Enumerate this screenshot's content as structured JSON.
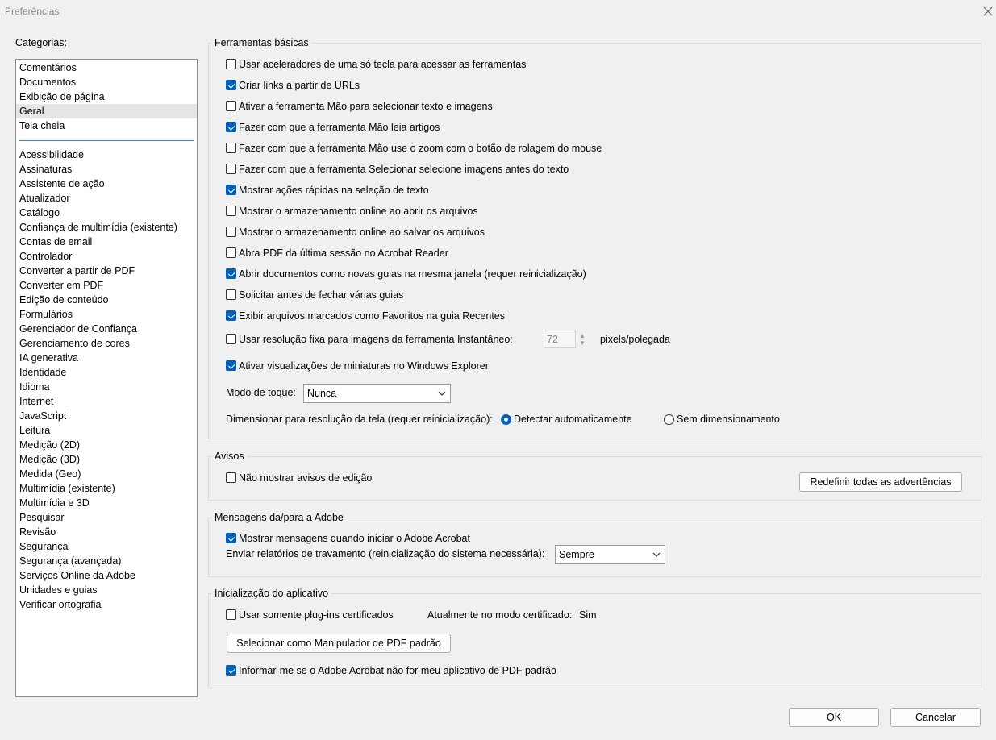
{
  "window": {
    "title": "Preferências"
  },
  "categories": {
    "label": "Categorias:",
    "top": [
      "Comentários",
      "Documentos",
      "Exibição de página",
      "Geral",
      "Tela cheia"
    ],
    "selected": "Geral",
    "bottom": [
      "Acessibilidade",
      "Assinaturas",
      "Assistente de ação",
      "Atualizador",
      "Catálogo",
      "Confiança de multimídia (existente)",
      "Contas de email",
      "Controlador",
      "Converter a partir de PDF",
      "Converter em PDF",
      "Edição de conteúdo",
      "Formulários",
      "Gerenciador de Confiança",
      "Gerenciamento de cores",
      "IA generativa",
      "Identidade",
      "Idioma",
      "Internet",
      "JavaScript",
      "Leitura",
      "Medição (2D)",
      "Medição (3D)",
      "Medida (Geo)",
      "Multimídia (existente)",
      "Multimídia e 3D",
      "Pesquisar",
      "Revisão",
      "Segurança",
      "Segurança (avançada)",
      "Serviços Online da Adobe",
      "Unidades e guias",
      "Verificar ortografia"
    ]
  },
  "basic_tools": {
    "title": "Ferramentas básicas",
    "options": [
      {
        "label": "Usar aceleradores de uma só tecla para acessar as ferramentas",
        "checked": false
      },
      {
        "label": "Criar links a partir de URLs",
        "checked": true
      },
      {
        "label": "Ativar a ferramenta Mão para selecionar texto e imagens",
        "checked": false
      },
      {
        "label": "Fazer com que a ferramenta Mão leia artigos",
        "checked": true
      },
      {
        "label": "Fazer com que a ferramenta Mão use o zoom com o botão de rolagem do mouse",
        "checked": false
      },
      {
        "label": "Fazer com que a ferramenta Selecionar selecione imagens antes do texto",
        "checked": false
      },
      {
        "label": "Mostrar ações rápidas na seleção de texto",
        "checked": true
      },
      {
        "label": "Mostrar o armazenamento online ao abrir os arquivos",
        "checked": false
      },
      {
        "label": "Mostrar o armazenamento online ao salvar os arquivos",
        "checked": false
      },
      {
        "label": "Abra PDF da última sessão no Acrobat Reader",
        "checked": false
      },
      {
        "label": "Abrir documentos como novas guias na mesma janela (requer reinicialização)",
        "checked": true
      },
      {
        "label": "Solicitar antes de fechar várias guias",
        "checked": false
      },
      {
        "label": "Exibir arquivos marcados como Favoritos na guia Recentes",
        "checked": true
      }
    ],
    "snapshot": {
      "label": "Usar resolução fixa para imagens da ferramenta Instantâneo:",
      "checked": false,
      "value": "72",
      "unit": "pixels/polegada"
    },
    "thumbnails": {
      "label": "Ativar visualizações de miniaturas no Windows Explorer",
      "checked": true
    },
    "touch_mode": {
      "label": "Modo de toque:",
      "value": "Nunca"
    },
    "scaling": {
      "label": "Dimensionar para resolução da tela (requer reinicialização):",
      "auto": "Detectar automaticamente",
      "none": "Sem dimensionamento",
      "selected": "auto"
    }
  },
  "warnings": {
    "title": "Avisos",
    "no_edit_warnings": {
      "label": "Não mostrar avisos de edição",
      "checked": false
    },
    "reset_button": "Redefinir todas as advertências"
  },
  "messages": {
    "title": "Mensagens da/para a Adobe",
    "show_messages": {
      "label": "Mostrar mensagens quando iniciar o Adobe Acrobat",
      "checked": true
    },
    "crash_reports": {
      "label": "Enviar relatórios de travamento (reinicialização do sistema necessária):",
      "value": "Sempre"
    }
  },
  "startup": {
    "title": "Inicialização do aplicativo",
    "certified": {
      "label": "Usar somente plug-ins certificados",
      "checked": false
    },
    "certified_mode": {
      "label": "Atualmente no modo certificado:",
      "value": "Sim"
    },
    "default_handler_button": "Selecionar como Manipulador de PDF padrão",
    "notify_default": {
      "label": "Informar-me se o Adobe Acrobat não for meu aplicativo de PDF padrão",
      "checked": true
    }
  },
  "footer": {
    "ok": "OK",
    "cancel": "Cancelar"
  },
  "colors": {
    "accent": "#005fb8",
    "separator": "#3c7fb1",
    "background": "#f0f0f0"
  }
}
